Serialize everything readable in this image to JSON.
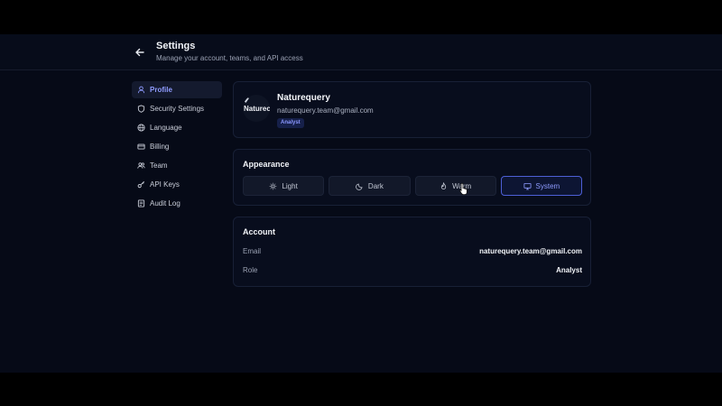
{
  "header": {
    "title": "Settings",
    "subtitle": "Manage your account, teams, and API access"
  },
  "sidebar": {
    "items": [
      {
        "label": "Profile",
        "icon": "user-icon",
        "active": true
      },
      {
        "label": "Security Settings",
        "icon": "shield-icon",
        "active": false
      },
      {
        "label": "Language",
        "icon": "globe-icon",
        "active": false
      },
      {
        "label": "Billing",
        "icon": "credit-card-icon",
        "active": false
      },
      {
        "label": "Team",
        "icon": "users-icon",
        "active": false
      },
      {
        "label": "API Keys",
        "icon": "key-icon",
        "active": false
      },
      {
        "label": "Audit Log",
        "icon": "log-icon",
        "active": false
      }
    ]
  },
  "profile": {
    "avatar_text": "Naturec",
    "name": "Naturequery",
    "email": "naturequery.team@gmail.com",
    "role_badge": "Analyst"
  },
  "appearance": {
    "title": "Appearance",
    "options": [
      {
        "label": "Light",
        "icon": "sun-icon",
        "selected": false
      },
      {
        "label": "Dark",
        "icon": "moon-icon",
        "selected": false
      },
      {
        "label": "Warm",
        "icon": "flame-icon",
        "selected": false
      },
      {
        "label": "System",
        "icon": "monitor-icon",
        "selected": true
      }
    ]
  },
  "account": {
    "title": "Account",
    "rows": [
      {
        "key": "Email",
        "value": "naturequery.team@gmail.com"
      },
      {
        "key": "Role",
        "value": "Analyst"
      }
    ]
  },
  "colors": {
    "accent": "#8e9bff",
    "background": "#060a17",
    "card": "#080d1d"
  }
}
